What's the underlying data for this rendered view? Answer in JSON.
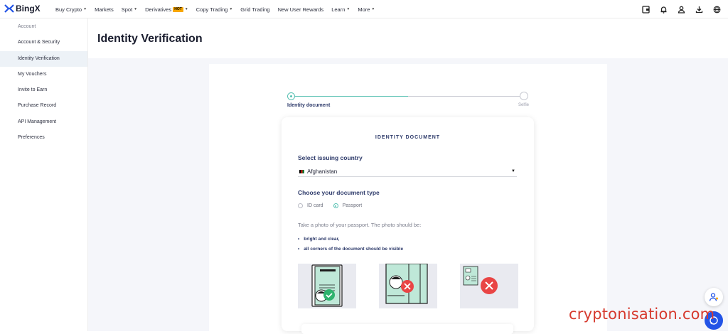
{
  "brand": {
    "name": "BingX",
    "accent": "#59c1b3",
    "logo_color": "#2354e6"
  },
  "nav": {
    "items": [
      {
        "label": "Buy Crypto",
        "caret": true
      },
      {
        "label": "Markets",
        "caret": false
      },
      {
        "label": "Spot",
        "caret": true
      },
      {
        "label": "Derivatives",
        "caret": true,
        "badge": "HOT"
      },
      {
        "label": "Copy Trading",
        "caret": true
      },
      {
        "label": "Grid Trading",
        "caret": false
      },
      {
        "label": "New User Rewards",
        "caret": false
      },
      {
        "label": "Learn",
        "caret": true
      },
      {
        "label": "More",
        "caret": true
      }
    ],
    "icons": [
      "wallet-icon",
      "bell-icon",
      "user-icon",
      "download-icon",
      "globe-icon"
    ]
  },
  "sidebar": {
    "items": [
      {
        "label": "Account"
      },
      {
        "label": "Account & Security"
      },
      {
        "label": "Identity Verification"
      },
      {
        "label": "My Vouchers"
      },
      {
        "label": "Invite to Earn"
      },
      {
        "label": "Purchase Record"
      },
      {
        "label": "API Management"
      },
      {
        "label": "Preferences"
      }
    ],
    "active_index": 2
  },
  "page": {
    "title": "Identity Verification"
  },
  "stepper": {
    "steps": [
      {
        "label": "Identity document"
      },
      {
        "label": "Selfie"
      }
    ],
    "current": 1
  },
  "card": {
    "title": "IDENTITY DOCUMENT",
    "country_label": "Select issuing country",
    "country_value": "Afghanistan",
    "doc_type_label": "Choose your document type",
    "doc_types": [
      {
        "label": "ID card",
        "selected": false
      },
      {
        "label": "Passport",
        "selected": true
      }
    ],
    "instruction": "Take a photo of your passport. The photo should be:",
    "bullets": [
      "bright and clear,",
      "all corners of the document should be visible"
    ],
    "examples": [
      {
        "icon": "passport-correct-icon",
        "status": "ok"
      },
      {
        "icon": "passport-cropped-icon",
        "status": "error"
      },
      {
        "icon": "passport-too-small-icon",
        "status": "error"
      }
    ]
  },
  "floating": {
    "icons": [
      "support-person-icon",
      "chat-icon"
    ]
  },
  "watermark": {
    "text": "cryptonisation.com"
  }
}
